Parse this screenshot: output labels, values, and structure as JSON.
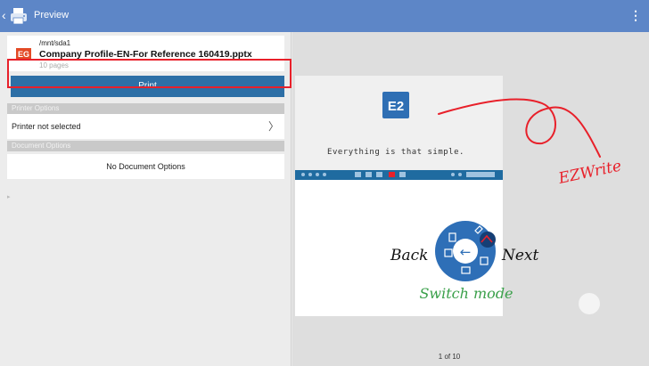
{
  "topbar": {
    "title": "Preview",
    "back_glyph": "‹",
    "overflow_glyph": "⋮",
    "app_icon": "printer-icon"
  },
  "file": {
    "path": "/mnt/sda1",
    "name": "Company Profile-EN-For Reference 160419.pptx",
    "pages": "10 pages",
    "icon_label": "EG"
  },
  "print_button": {
    "label": "Print"
  },
  "printer_options": {
    "header": "Printer Options",
    "printer_label": "Printer not selected",
    "chevron": "〉"
  },
  "document_options": {
    "header": "Document Options",
    "value": "No Document Options"
  },
  "side_handle_glyph": "▸",
  "preview": {
    "slide_logo_text": "E2",
    "tagline": "Everything is that simple.",
    "ezwrite_label": "EZWrite",
    "back_label": "Back",
    "next_label": "Next",
    "switch_mode_label": "Switch mode",
    "page_indicator": "1 of 10"
  },
  "colors": {
    "topbar": "#5d86c7",
    "print_button": "#2d6fa6",
    "highlight": "#e8202a",
    "annotation_red": "#e8202a",
    "switch_mode_green": "#3aa04a"
  }
}
